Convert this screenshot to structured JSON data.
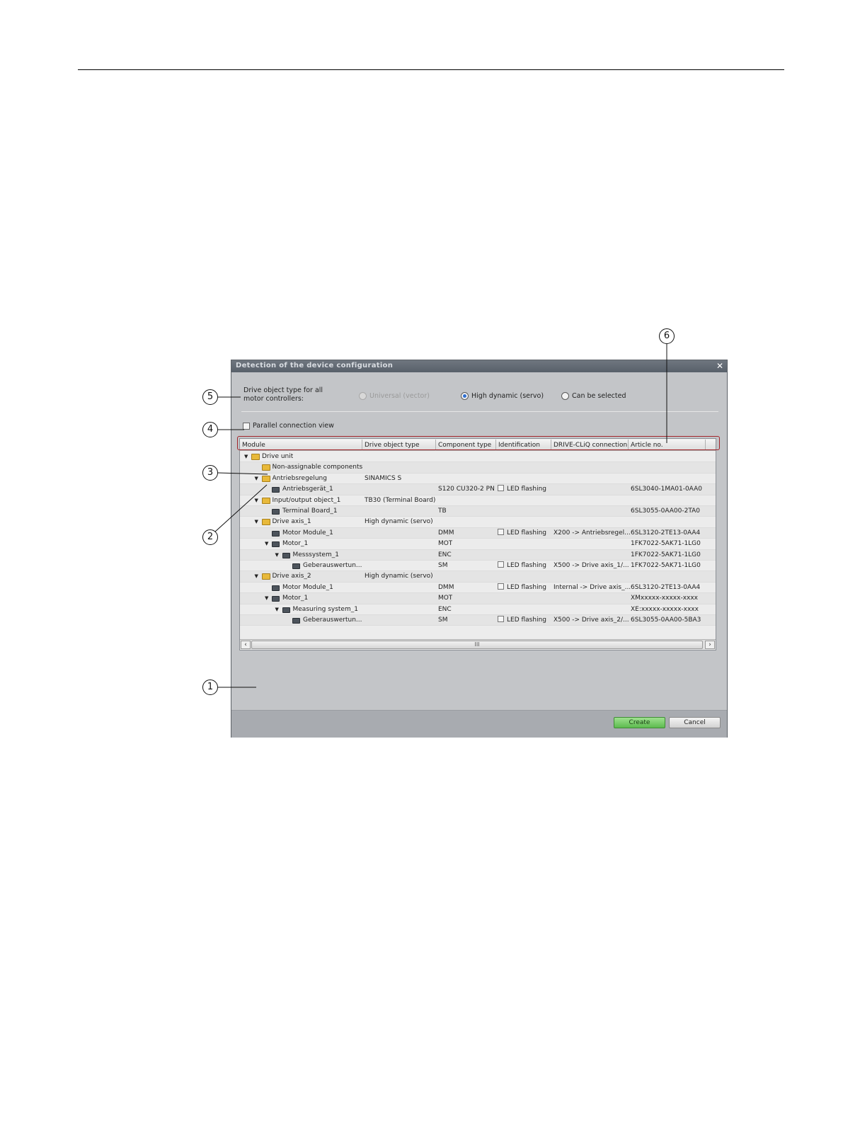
{
  "dialog": {
    "title": "Detection of the device configuration",
    "drive_type_label": "Drive object type for all motor controllers:",
    "radio_options": [
      {
        "label": "Universal (vector)",
        "state": "disabled"
      },
      {
        "label": "High dynamic (servo)",
        "state": "checked"
      },
      {
        "label": "Can be selected",
        "state": "unchecked"
      }
    ],
    "parallel_view_label": "Parallel connection view",
    "columns": [
      "Module",
      "Drive object type",
      "Component type",
      "Identification",
      "DRIVE-CLiQ connection",
      "Article no."
    ],
    "rows": [
      {
        "module": "Drive unit",
        "drive_type": "",
        "comp": "",
        "ident": "",
        "dcliq": "",
        "article": ""
      },
      {
        "module": "Non-assignable components",
        "drive_type": "",
        "comp": "",
        "ident": "",
        "dcliq": "",
        "article": ""
      },
      {
        "module": "Antriebsregelung",
        "drive_type": "SINAMICS S",
        "comp": "",
        "ident": "",
        "dcliq": "",
        "article": ""
      },
      {
        "module": "Antriebsgerät_1",
        "drive_type": "",
        "comp": "S120 CU320-2 PN",
        "ident": "LED flashing",
        "dcliq": "",
        "article": "6SL3040-1MA01-0AA0"
      },
      {
        "module": "Input/output object_1",
        "drive_type": "TB30 (Terminal Board)",
        "comp": "",
        "ident": "",
        "dcliq": "",
        "article": ""
      },
      {
        "module": "Terminal Board_1",
        "drive_type": "",
        "comp": "TB",
        "ident": "",
        "dcliq": "",
        "article": "6SL3055-0AA00-2TA0"
      },
      {
        "module": "Drive axis_1",
        "drive_type": "High dynamic (servo)",
        "comp": "",
        "ident": "",
        "dcliq": "",
        "article": ""
      },
      {
        "module": "Motor Module_1",
        "drive_type": "",
        "comp": "DMM",
        "ident": "LED flashing",
        "dcliq": "X200 -> Antriebsregel...",
        "article": "6SL3120-2TE13-0AA4"
      },
      {
        "module": "Motor_1",
        "drive_type": "",
        "comp": "MOT",
        "ident": "",
        "dcliq": "",
        "article": "1FK7022-5AK71-1LG0"
      },
      {
        "module": "Messsystem_1",
        "drive_type": "",
        "comp": "ENC",
        "ident": "",
        "dcliq": "",
        "article": "1FK7022-5AK71-1LG0"
      },
      {
        "module": "Geberauswertun...",
        "drive_type": "",
        "comp": "SM",
        "ident": "LED flashing",
        "dcliq": "X500 -> Drive axis_1/...",
        "article": "1FK7022-5AK71-1LG0"
      },
      {
        "module": "Drive axis_2",
        "drive_type": "High dynamic (servo)",
        "comp": "",
        "ident": "",
        "dcliq": "",
        "article": ""
      },
      {
        "module": "Motor Module_1",
        "drive_type": "",
        "comp": "DMM",
        "ident": "LED flashing",
        "dcliq": "Internal -> Drive axis_...",
        "article": "6SL3120-2TE13-0AA4"
      },
      {
        "module": "Motor_1",
        "drive_type": "",
        "comp": "MOT",
        "ident": "",
        "dcliq": "",
        "article": "XMxxxxx-xxxxx-xxxx"
      },
      {
        "module": "Measuring system_1",
        "drive_type": "",
        "comp": "ENC",
        "ident": "",
        "dcliq": "",
        "article": "XE:xxxxx-xxxxx-xxxx"
      },
      {
        "module": "Geberauswertun...",
        "drive_type": "",
        "comp": "SM",
        "ident": "LED flashing",
        "dcliq": "X500 -> Drive axis_2/...",
        "article": "6SL3055-0AA00-5BA3"
      }
    ],
    "scroll_thumb_label": "III",
    "buttons": {
      "create": "Create",
      "cancel": "Cancel"
    }
  },
  "callouts": [
    "1",
    "2",
    "3",
    "4",
    "5",
    "6"
  ]
}
